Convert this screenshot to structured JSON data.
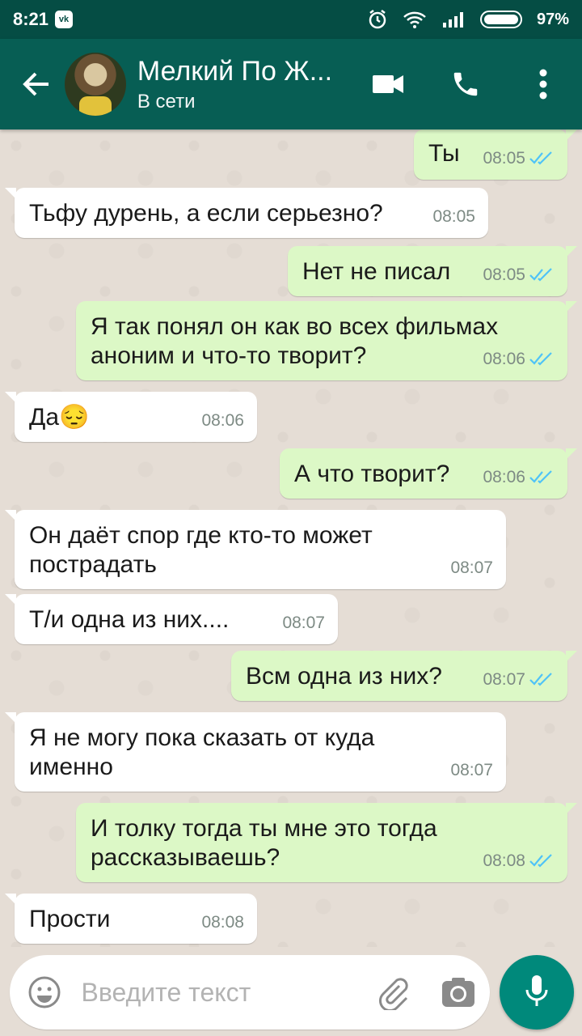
{
  "status_bar": {
    "time": "8:21",
    "vk_badge": "vk",
    "battery": "97%"
  },
  "header": {
    "contact_name": "Мелкий По Ж...",
    "status": "В сети"
  },
  "messages": [
    {
      "dir": "out",
      "text": "Ты",
      "time": "08:05",
      "read": true
    },
    {
      "dir": "in",
      "text": "Тьфу дурень, а если серьезно?",
      "time": "08:05"
    },
    {
      "dir": "out",
      "text": "Нет не писал",
      "time": "08:05",
      "read": true
    },
    {
      "dir": "out",
      "text": "Я так понял он как во всех фильмах аноним и что-то творит?",
      "time": "08:06",
      "read": true
    },
    {
      "dir": "in",
      "text": "Да😔",
      "time": "08:06"
    },
    {
      "dir": "out",
      "text": "А что творит?",
      "time": "08:06",
      "read": true
    },
    {
      "dir": "in",
      "text": "Он даёт спор где кто-то может пострадать",
      "time": "08:07"
    },
    {
      "dir": "in",
      "text": "Т/и одна из них....",
      "time": "08:07"
    },
    {
      "dir": "out",
      "text": "Всм одна из них?",
      "time": "08:07",
      "read": true
    },
    {
      "dir": "in",
      "text": "Я не могу пока сказать от куда именно",
      "time": "08:07"
    },
    {
      "dir": "out",
      "text": "И толку тогда ты мне это тогда рассказываешь?",
      "time": "08:08",
      "read": true
    },
    {
      "dir": "in",
      "text": "Прости",
      "time": "08:08"
    }
  ],
  "composer": {
    "placeholder": "Введите текст"
  },
  "colors": {
    "header": "#075e54",
    "status_bar": "#054d44",
    "outgoing_bubble": "#dcf8c6",
    "read_ticks": "#4fc3f7",
    "mic_button": "#00897b"
  },
  "icons": [
    "back-arrow-icon",
    "video-call-icon",
    "phone-icon",
    "more-vert-icon",
    "emoji-icon",
    "paperclip-icon",
    "camera-icon",
    "mic-icon",
    "double-check-icon"
  ]
}
